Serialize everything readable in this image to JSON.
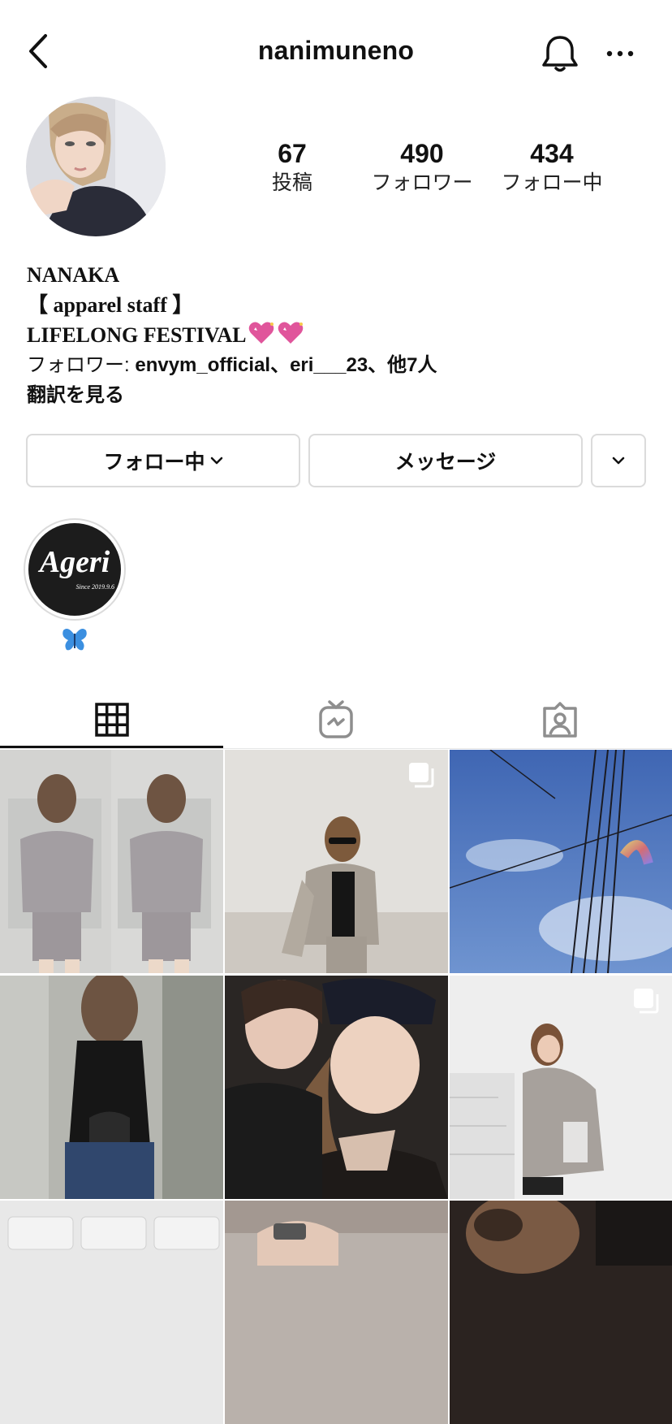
{
  "header": {
    "username": "nanimuneno"
  },
  "profile": {
    "stats": [
      {
        "value": "67",
        "label": "投稿"
      },
      {
        "value": "490",
        "label": "フォロワー"
      },
      {
        "value": "434",
        "label": "フォロー中"
      }
    ],
    "name": "NANAKA",
    "bio_line1": "【 apparel staff 】",
    "bio_line2": "LIFELONG FESTIVAL",
    "followed_by_prefix": "フォロワー: ",
    "followed_by_names": "envym_official、eri___23、他7人",
    "translate": "翻訳を見る"
  },
  "actions": {
    "following_label": "フォロー中",
    "message_label": "メッセージ"
  },
  "highlight": {
    "logo_text": "Ageri",
    "logo_since": "Since 2019.9.6"
  },
  "tabs": [
    "grid-icon",
    "igtv-icon",
    "tagged-icon"
  ],
  "colors": {
    "text": "#111111",
    "border": "#dbdbdb",
    "highlight_bg": "#1c1c1c",
    "heart": "#e0559b",
    "butterfly": "#3b8fe0"
  }
}
